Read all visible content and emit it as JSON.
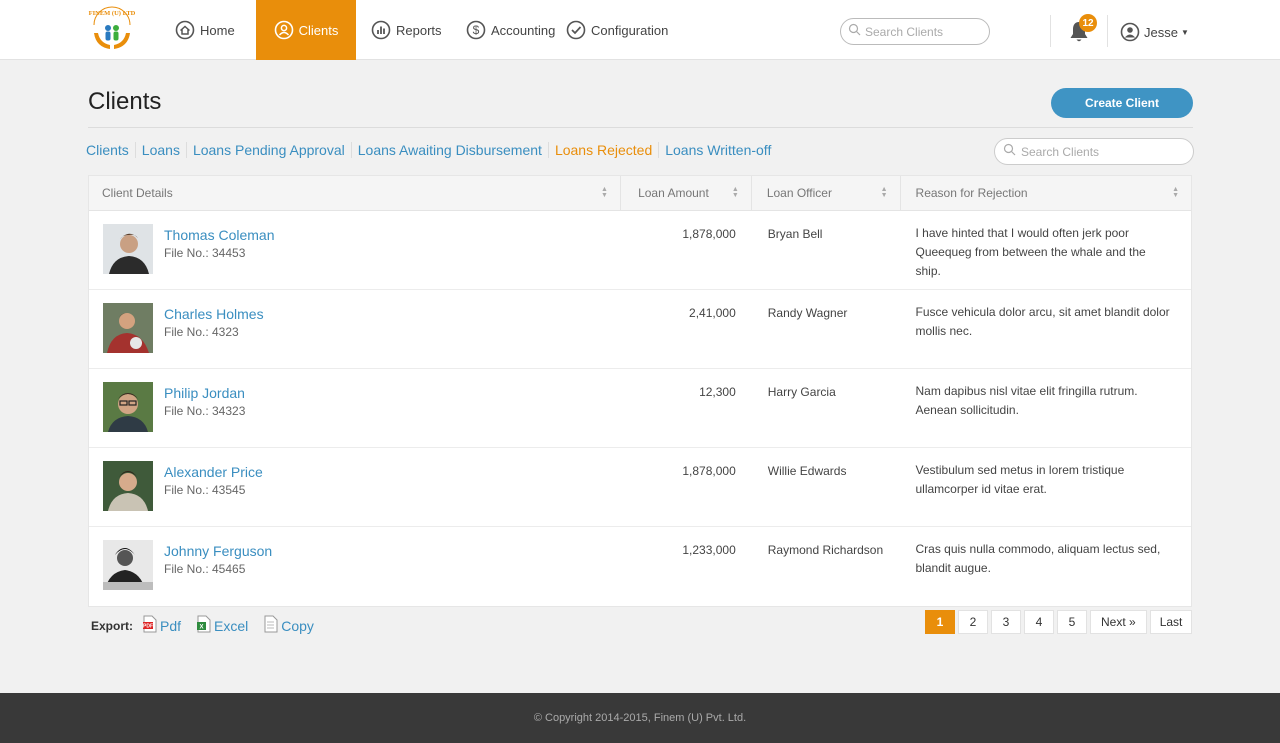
{
  "nav": {
    "items": [
      {
        "label": "Home",
        "icon": "home-icon"
      },
      {
        "label": "Clients",
        "icon": "user-circle-icon"
      },
      {
        "label": "Reports",
        "icon": "bar-chart-icon"
      },
      {
        "label": "Accounting",
        "icon": "dollar-icon"
      },
      {
        "label": "Configuration",
        "icon": "check-circle-icon"
      }
    ],
    "active": "Clients",
    "logo_text": "FINEM (U) LTD",
    "search_placeholder": "Search Clients",
    "notifications_count": "12",
    "user_name": "Jesse"
  },
  "page": {
    "title": "Clients",
    "create_button": "Create Client"
  },
  "subnav": {
    "tabs": [
      "Clients",
      "Loans",
      "Loans Pending Approval",
      "Loans Awaiting Disbursement",
      "Loans Rejected",
      "Loans Written-off"
    ],
    "active": "Loans Rejected",
    "search_placeholder": "Search Clients"
  },
  "table": {
    "headers": [
      "Client Details",
      "Loan Amount",
      "Loan Officer",
      "Reason for Rejection"
    ],
    "rows": [
      {
        "name": "Thomas Coleman",
        "file_no": "File No.: 34453",
        "amount": "1,878,000",
        "officer": "Bryan Bell",
        "reason": "I have hinted that I would often jerk poor Queequeg from between the whale and the ship."
      },
      {
        "name": "Charles Holmes",
        "file_no": "File No.: 4323",
        "amount": "2,41,000",
        "officer": "Randy Wagner",
        "reason": "Fusce vehicula dolor arcu, sit amet blandit dolor mollis nec."
      },
      {
        "name": "Philip Jordan",
        "file_no": "File No.: 34323",
        "amount": "12,300",
        "officer": "Harry Garcia",
        "reason": "Nam dapibus nisl vitae elit fringilla rutrum. Aenean sollicitudin."
      },
      {
        "name": "Alexander Price",
        "file_no": "File No.: 43545",
        "amount": "1,878,000",
        "officer": "Willie Edwards",
        "reason": "Vestibulum sed metus in lorem tristique ullamcorper id vitae erat."
      },
      {
        "name": "Johnny Ferguson",
        "file_no": "File No.: 45465",
        "amount": "1,233,000",
        "officer": "Raymond Richardson",
        "reason": "Cras quis nulla commodo, aliquam lectus sed, blandit augue."
      }
    ]
  },
  "export": {
    "label": "Export:",
    "options": [
      {
        "label": "Pdf",
        "icon": "pdf-file-icon"
      },
      {
        "label": "Excel",
        "icon": "excel-file-icon"
      },
      {
        "label": "Copy",
        "icon": "copy-document-icon"
      }
    ]
  },
  "pagination": {
    "pages": [
      "1",
      "2",
      "3",
      "4",
      "5"
    ],
    "current": "1",
    "next": "Next »",
    "last": "Last"
  },
  "footer": {
    "copyright": "© Copyright 2014-2015, Finem (U) Pvt. Ltd."
  },
  "colors": {
    "accent": "#e98e0b",
    "link": "#3a8ec0",
    "button": "#3f94c4",
    "footer": "#393939"
  }
}
